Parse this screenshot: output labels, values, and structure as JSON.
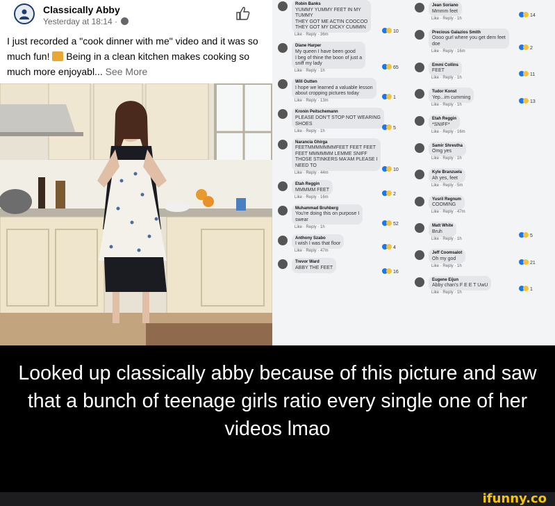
{
  "post": {
    "name": "Classically Abby",
    "meta": "Yesterday at 18:14 ·",
    "text_before_icon": "I just recorded a \"cook dinner with me\" video and it was so much fun!",
    "text_after_icon": " Being in a clean kitchen makes cooking so much more enjoyabl...",
    "see_more": " See More"
  },
  "comments": [
    {
      "name": "Robin Banks",
      "text": "YUMMY YUMMY FEET IN MY\nTUMMY\nTHEY GOT ME ACTIN COOCOO\nTHEY GOT MY DICKY CUMMIN",
      "actions": "Like · Reply · 36m",
      "reactions": "10"
    },
    {
      "name": "Diane Harper",
      "text": "My queen I have been good\nI beg of thine the boon of just a\nsniff my lady",
      "actions": "Like · Reply · 1h",
      "reactions": "65"
    },
    {
      "name": "Will Outten",
      "text": "I hope we learned a valuable lesson\nabout cropping pictures today",
      "actions": "Like · Reply · 13m",
      "reactions": "1"
    },
    {
      "name": "Kronin Peitschemann",
      "text": "PLEASE DON'T STOP NOT WEARING\nSHOES",
      "actions": "Like · Reply · 1h",
      "reactions": "5"
    },
    {
      "name": "Narancia Ghirga",
      "text": "FEETMMMMMMMFEET FEET FEET\nFEET MMMMMM LEMME SNIFF\nTHOSE STINKERS MA'AM PLEASE I\nNEED TO",
      "actions": "Like · Reply · 44m",
      "reactions": "10"
    },
    {
      "name": "Etah Reggin",
      "text": "MMMMM FEET",
      "actions": "Like · Reply · 16m",
      "reactions": "2"
    },
    {
      "name": "Muhammad Bruhberg",
      "text": "You're doing this on purpose I\nswear",
      "actions": "Like · Reply · 1h",
      "reactions": "52"
    },
    {
      "name": "Anthony Szabo",
      "text": "I wish I was that floor",
      "actions": "Like · Reply · 47m",
      "reactions": "4"
    },
    {
      "name": "Trevor Ward",
      "text": "ABBY THE FEET",
      "actions": "",
      "reactions": "16"
    }
  ],
  "comments_right": [
    {
      "name": "Jean Soriano",
      "text": "Mmmm feet",
      "actions": "Like · Reply · 1h",
      "reactions": "14"
    },
    {
      "name": "Precious Galazios Smith",
      "text": "Oooo gurl where you get dem feet\ndoe",
      "actions": "Like · Reply · 16m",
      "reactions": "2"
    },
    {
      "name": "Emmi Collins",
      "text": "FEET",
      "actions": "Like · Reply · 1h",
      "reactions": "11"
    },
    {
      "name": "Tudor Konst",
      "text": "Yep...im cumming",
      "actions": "Like · Reply · 1h",
      "reactions": "13"
    },
    {
      "name": "Etah Reggin",
      "text": "*SNIFF*",
      "actions": "Like · Reply · 16m",
      "reactions": ""
    },
    {
      "name": "Samir Shrestha",
      "text": "Omg yes",
      "actions": "Like · Reply · 1h",
      "reactions": ""
    },
    {
      "name": "Kyle Branzuela",
      "text": "Ah yes, feet",
      "actions": "Like · Reply · 5m",
      "reactions": ""
    },
    {
      "name": "Yusril Regnum",
      "text": "COOMING",
      "actions": "Like · Reply · 47m",
      "reactions": ""
    },
    {
      "name": "Matt White",
      "text": "Bruh",
      "actions": "Like · Reply · 1h",
      "reactions": "5"
    },
    {
      "name": "Jeff Coomsalot",
      "text": "Oh my god",
      "actions": "Like · Reply · 1h",
      "reactions": "21"
    },
    {
      "name": "Eugene Eijun",
      "text": "Abby chan's F E E T UwU",
      "actions": "Like · Reply · 1h",
      "reactions": "1"
    }
  ],
  "caption": "Looked up classically abby because of this picture and saw that a bunch of teenage girls ratio every single one of her videos lmao",
  "watermark": "ifunny.co",
  "colors": {
    "caption_bg": "#000000",
    "caption_text": "#ffffff",
    "watermark": "#f7c400",
    "link_blue": "#1877f2"
  }
}
